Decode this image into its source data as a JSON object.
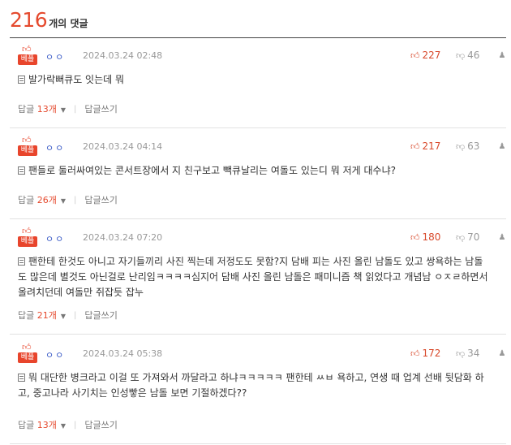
{
  "header": {
    "count": "216",
    "label": "개의 댓글"
  },
  "badge_label": "베플",
  "icons": {
    "best": "thumbs-up-icon",
    "up": "thumbs-up-icon",
    "down": "thumbs-down-icon",
    "report": "report-icon",
    "doc": "document-icon",
    "caret": "caret-down-icon"
  },
  "colors": {
    "accent": "#e5492d",
    "author": "#3a5bc7"
  },
  "comments": [
    {
      "author": "ㅇㅇ",
      "date": "2024.03.24 02:48",
      "up": "227",
      "down": "46",
      "text": "발가락뻐큐도 잇는데 뭐",
      "reply_prefix": "답글",
      "reply_count": "13개",
      "write_reply": "답글쓰기"
    },
    {
      "author": "ㅇㅇ",
      "date": "2024.03.24 04:14",
      "up": "217",
      "down": "63",
      "text": "팬들로 둘러싸여있는 콘서트장에서 지 친구보고 빽큐날리는 여돌도 있는디 뭐 저게 대수냐?",
      "reply_prefix": "답글",
      "reply_count": "26개",
      "write_reply": "답글쓰기"
    },
    {
      "author": "ㅇㅇ",
      "date": "2024.03.24 07:20",
      "up": "180",
      "down": "70",
      "text": "팬한테 한것도 아니고 자기들끼리 사진 찍는데 저정도도 못함?지 담배 피는 사진 올린 남돌도 있고 쌍욕하는 남돌도 많은데 별것도 아닌걸로 난리임ㅋㅋㅋㅋ심지어 담배 사진 올린 남돌은 패미니즘 책 읽었다고 개념남 ㅇㅈㄹ하면서 올려치던데 여돌만 쥐잡듯 잡누",
      "reply_prefix": "답글",
      "reply_count": "21개",
      "write_reply": "답글쓰기"
    },
    {
      "author": "ㅇㅇ",
      "date": "2024.03.24 05:38",
      "up": "172",
      "down": "34",
      "text": "뭐 대단한 병크라고 이걸 또 가져와서 까달라고 하냐ㅋㅋㅋㅋㅋ 팬한테 ㅆㅂ 욕하고, 연생 때 업계 선배 뒷담화 하고, 중고나라 사기치는 인성빻은 남돌 보면 기절하겠다??",
      "reply_prefix": "답글",
      "reply_count": "13개",
      "write_reply": "답글쓰기"
    }
  ]
}
